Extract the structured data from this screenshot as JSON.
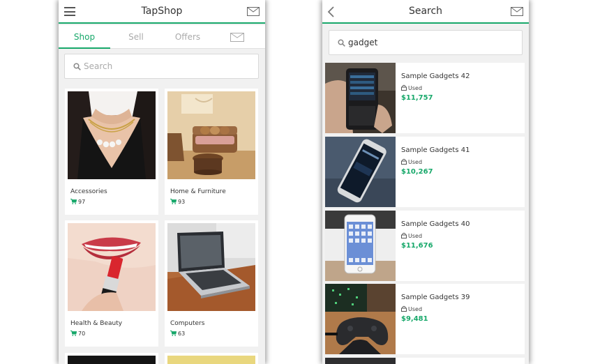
{
  "colors": {
    "accent": "#17a86a",
    "background": "#f1f1f1"
  },
  "shop_screen": {
    "title": "TapShop",
    "tabs": [
      "Shop",
      "Sell",
      "Offers"
    ],
    "search_placeholder": "Search",
    "categories": [
      {
        "label": "Accessories",
        "count": "97"
      },
      {
        "label": "Home & Furniture",
        "count": "93"
      },
      {
        "label": "Health & Beauty",
        "count": "70"
      },
      {
        "label": "Computers",
        "count": "63"
      }
    ]
  },
  "search_screen": {
    "title": "Search",
    "query": "gadget",
    "results": [
      {
        "name": "Sample Gadgets 42",
        "condition": "Used",
        "price": "$11,757"
      },
      {
        "name": "Sample Gadgets 41",
        "condition": "Used",
        "price": "$10,267"
      },
      {
        "name": "Sample Gadgets 40",
        "condition": "Used",
        "price": "$11,676"
      },
      {
        "name": "Sample Gadgets 39",
        "condition": "Used",
        "price": "$9,481"
      }
    ]
  },
  "icons": [
    "hamburger-icon",
    "envelope-icon",
    "search-icon",
    "cart-icon",
    "lock-icon",
    "back-arrow-icon"
  ]
}
